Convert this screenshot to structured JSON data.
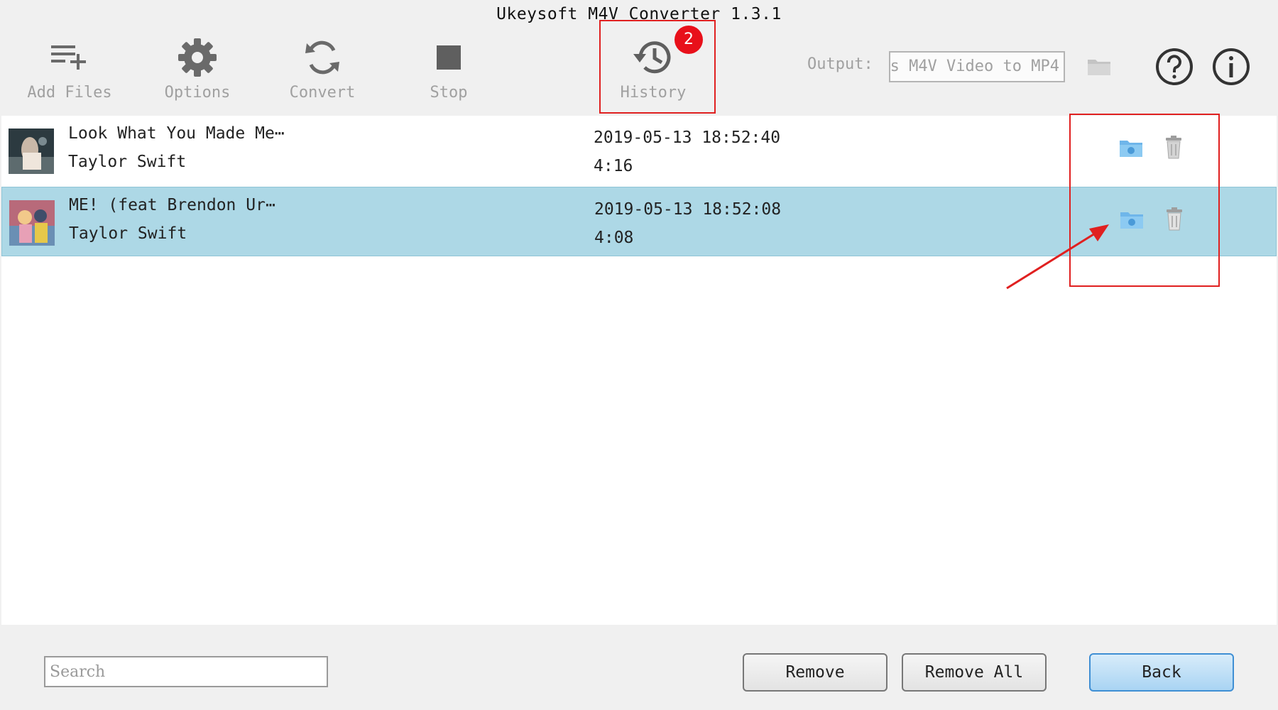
{
  "window": {
    "title": "Ukeysoft M4V Converter 1.3.1"
  },
  "toolbar": {
    "add_files": "Add Files",
    "options": "Options",
    "convert": "Convert",
    "stop": "Stop",
    "history": "History",
    "history_badge": "2",
    "output_label": "Output:",
    "output_value": "s M4V Video to MP4"
  },
  "history_list": [
    {
      "title": "Look What You Made Me⋯",
      "artist": "Taylor Swift",
      "date": "2019-05-13 18:52:40",
      "duration": "4:16",
      "selected": false
    },
    {
      "title": "ME! (feat  Brendon Ur⋯",
      "artist": "Taylor Swift",
      "date": "2019-05-13 18:52:08",
      "duration": "4:08",
      "selected": true
    }
  ],
  "footer": {
    "search_placeholder": "Search",
    "remove": "Remove",
    "remove_all": "Remove All",
    "back": "Back"
  },
  "colors": {
    "selected_row": "#add8e6",
    "highlight_box": "#e02020",
    "badge": "#e8101a",
    "primary_button": "#a9d4f3"
  },
  "icons": {
    "add_files": "playlist-add-icon",
    "options": "gear-icon",
    "convert": "refresh-icon",
    "stop": "stop-square-icon",
    "history": "history-clock-icon",
    "output_folder": "folder-icon",
    "help": "question-circle-icon",
    "about": "info-circle-icon",
    "open_folder": "folder-open-icon",
    "delete": "trash-icon"
  }
}
